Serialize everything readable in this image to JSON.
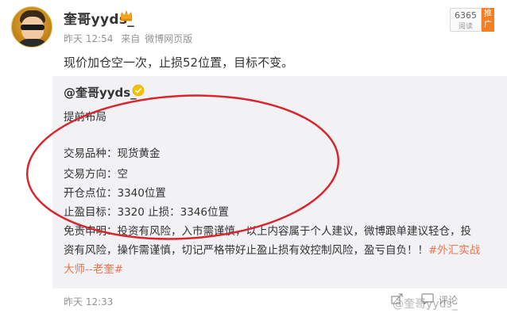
{
  "post": {
    "username": "奎哥yyds_",
    "time": "昨天 12:54",
    "source_prefix": "来自",
    "source": "微博网页版",
    "text": "现价加仓空一次，止损52位置，目标不变。",
    "follow_count": "6365",
    "follow_label": "阅读",
    "promo_label": "推广"
  },
  "repost": {
    "username": "@奎哥yyds_",
    "lines": [
      "提前布局",
      "交易品种：现货黄金",
      "交易方向：空",
      "开仓点位：3340位置",
      "止盈目标：3320 止损：3346位置",
      "免责申明：投资有风险，入市需谨慎，以上内容属于个人建议，微博跟单建议轻仓，投",
      "资有风险，操作需谨慎，切记严格带好止盈止损有效控制风险，盈亏自负！！",
      "大师--老奎"
    ],
    "hashtag_part1": "#外汇实战",
    "hashtag_part2": "大师--老奎#",
    "time": "昨天 12:33",
    "comment_label": "评论"
  },
  "watermark": "@奎哥yyds_",
  "colors": {
    "accent": "#eb7350",
    "circle": "#d9262c",
    "promo": "#f27f24"
  }
}
